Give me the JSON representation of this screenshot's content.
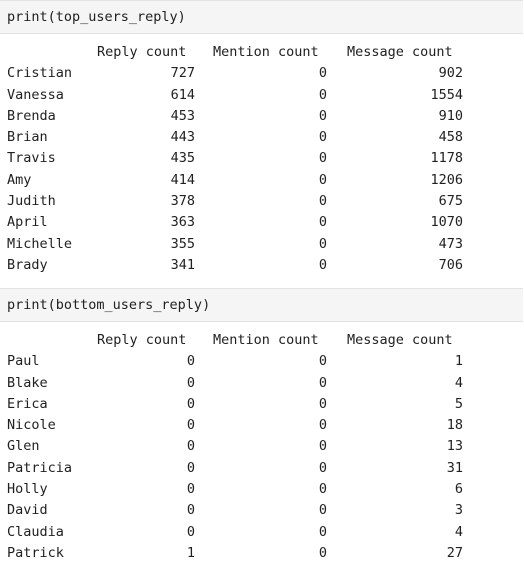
{
  "cells": [
    {
      "code": "print(top_users_reply)",
      "columns": [
        "Reply count",
        "Mention count",
        "Message count"
      ],
      "rows": [
        {
          "name": "Cristian",
          "reply": "727",
          "mention": "0",
          "message": "902"
        },
        {
          "name": "Vanessa",
          "reply": "614",
          "mention": "0",
          "message": "1554"
        },
        {
          "name": "Brenda",
          "reply": "453",
          "mention": "0",
          "message": "910"
        },
        {
          "name": "Brian",
          "reply": "443",
          "mention": "0",
          "message": "458"
        },
        {
          "name": "Travis",
          "reply": "435",
          "mention": "0",
          "message": "1178"
        },
        {
          "name": "Amy",
          "reply": "414",
          "mention": "0",
          "message": "1206"
        },
        {
          "name": "Judith",
          "reply": "378",
          "mention": "0",
          "message": "675"
        },
        {
          "name": "April",
          "reply": "363",
          "mention": "0",
          "message": "1070"
        },
        {
          "name": "Michelle",
          "reply": "355",
          "mention": "0",
          "message": "473"
        },
        {
          "name": "Brady",
          "reply": "341",
          "mention": "0",
          "message": "706"
        }
      ]
    },
    {
      "code": "print(bottom_users_reply)",
      "columns": [
        "Reply count",
        "Mention count",
        "Message count"
      ],
      "rows": [
        {
          "name": "Paul",
          "reply": "0",
          "mention": "0",
          "message": "1"
        },
        {
          "name": "Blake",
          "reply": "0",
          "mention": "0",
          "message": "4"
        },
        {
          "name": "Erica",
          "reply": "0",
          "mention": "0",
          "message": "5"
        },
        {
          "name": "Nicole",
          "reply": "0",
          "mention": "0",
          "message": "18"
        },
        {
          "name": "Glen",
          "reply": "0",
          "mention": "0",
          "message": "13"
        },
        {
          "name": "Patricia",
          "reply": "0",
          "mention": "0",
          "message": "31"
        },
        {
          "name": "Holly",
          "reply": "0",
          "mention": "0",
          "message": "6"
        },
        {
          "name": "David",
          "reply": "0",
          "mention": "0",
          "message": "3"
        },
        {
          "name": "Claudia",
          "reply": "0",
          "mention": "0",
          "message": "4"
        },
        {
          "name": "Patrick",
          "reply": "1",
          "mention": "0",
          "message": "27"
        }
      ]
    }
  ]
}
